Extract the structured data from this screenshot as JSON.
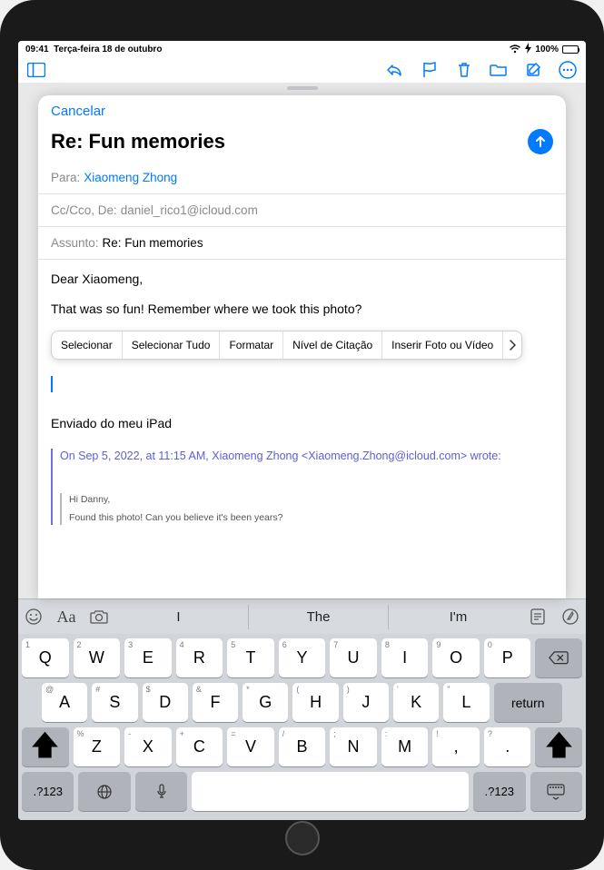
{
  "statusBar": {
    "time": "09:41",
    "date": "Terça-feira 18 de outubro",
    "batteryText": "100%"
  },
  "toolbarBg": {
    "panelLeft": "sidebar-icon",
    "panelRight": "chevron-icon"
  },
  "compose": {
    "cancel": "Cancelar",
    "title": "Re: Fun memories",
    "toLabel": "Para:",
    "toValue": "Xiaomeng Zhong",
    "ccLabel": "Cc/Cco, De:",
    "ccValue": "daniel_rico1@icloud.com",
    "subjectLabel": "Assunto:",
    "subjectValue": "Re: Fun memories",
    "body": {
      "line1": "Dear Xiaomeng,",
      "line2": "That was so fun! Remember where we took this photo?"
    },
    "signature": "Enviado do meu iPad",
    "quote": {
      "header": "On Sep 5, 2022, at 11:15 AM, Xiaomeng Zhong <Xiaomeng.Zhong@icloud.com> wrote:",
      "nested": {
        "l1": "Hi Danny,",
        "l2": "Found this photo! Can you believe it's been years?"
      }
    }
  },
  "contextMenu": {
    "items": [
      "Selecionar",
      "Selecionar Tudo",
      "Formatar",
      "Nível de Citação",
      "Inserir Foto ou Vídeo"
    ]
  },
  "keyboard": {
    "suggestions": [
      "I",
      "The",
      "I'm"
    ],
    "row1": [
      {
        "main": "Q",
        "l": "1",
        "r": ""
      },
      {
        "main": "W",
        "l": "2",
        "r": ""
      },
      {
        "main": "E",
        "l": "3",
        "r": ""
      },
      {
        "main": "R",
        "l": "4",
        "r": ""
      },
      {
        "main": "T",
        "l": "5",
        "r": ""
      },
      {
        "main": "Y",
        "l": "6",
        "r": ""
      },
      {
        "main": "U",
        "l": "7",
        "r": ""
      },
      {
        "main": "I",
        "l": "8",
        "r": ""
      },
      {
        "main": "O",
        "l": "9",
        "r": ""
      },
      {
        "main": "P",
        "l": "0",
        "r": ""
      }
    ],
    "row2": [
      {
        "main": "A",
        "l": "@",
        "r": ""
      },
      {
        "main": "S",
        "l": "#",
        "r": ""
      },
      {
        "main": "D",
        "l": "$",
        "r": ""
      },
      {
        "main": "F",
        "l": "&",
        "r": ""
      },
      {
        "main": "G",
        "l": "*",
        "r": ""
      },
      {
        "main": "H",
        "l": "(",
        "r": ""
      },
      {
        "main": "J",
        "l": ")",
        "r": ""
      },
      {
        "main": "K",
        "l": "'",
        "r": ""
      },
      {
        "main": "L",
        "l": "\"",
        "r": ""
      }
    ],
    "row3": [
      {
        "main": "Z",
        "l": "%",
        "r": ""
      },
      {
        "main": "X",
        "l": "-",
        "r": ""
      },
      {
        "main": "C",
        "l": "+",
        "r": ""
      },
      {
        "main": "V",
        "l": "=",
        "r": ""
      },
      {
        "main": "B",
        "l": "/",
        "r": ""
      },
      {
        "main": "N",
        "l": ";",
        "r": ""
      },
      {
        "main": "M",
        "l": ":",
        "r": ""
      },
      {
        "main": ",",
        "l": "!",
        "r": ""
      },
      {
        "main": ".",
        "l": "?",
        "r": ""
      }
    ],
    "returnLabel": "return",
    "numKey": ".?123"
  }
}
